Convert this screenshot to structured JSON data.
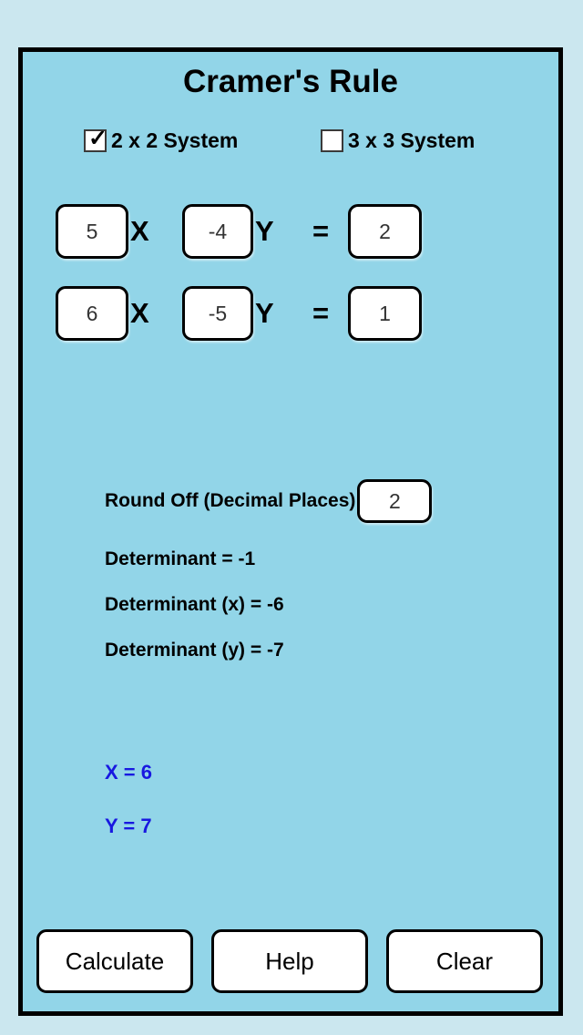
{
  "app": {
    "title": "Cramer's Rule",
    "panel_bg": "#92d5e8",
    "page_bg": "#cbe7ef",
    "border_color": "#000000",
    "solution_color": "#1818e0"
  },
  "system_options": [
    {
      "label": "2 x 2 System",
      "checked": true,
      "check_glyph": "✓"
    },
    {
      "label": "3 x 3 System",
      "checked": false,
      "check_glyph": ""
    }
  ],
  "equations": [
    {
      "coef_a": "5",
      "var_a": "X",
      "coef_b": "-4",
      "var_b": "Y",
      "equals": "=",
      "rhs": "2"
    },
    {
      "coef_a": "6",
      "var_a": "X",
      "coef_b": "-5",
      "var_b": "Y",
      "equals": "=",
      "rhs": "1"
    }
  ],
  "round_off": {
    "label": "Round Off (Decimal Places)",
    "value": "2"
  },
  "determinants": [
    "Determinant = -1",
    "Determinant (x) = -6",
    "Determinant (y) = -7"
  ],
  "solutions": [
    "X = 6",
    "Y = 7"
  ],
  "buttons": [
    "Calculate",
    "Help",
    "Clear"
  ]
}
